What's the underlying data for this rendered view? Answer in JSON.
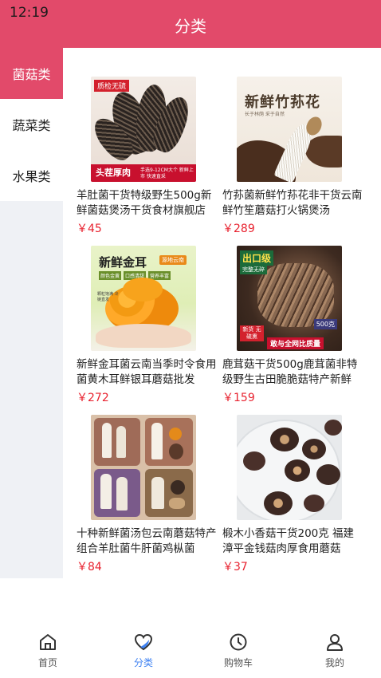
{
  "status_bar": {
    "time": "12:19"
  },
  "header": {
    "title": "分类"
  },
  "sidebar": {
    "items": [
      {
        "label": "菌菇类",
        "active": true
      },
      {
        "label": "蔬菜类",
        "active": false
      },
      {
        "label": "水果类",
        "active": false
      }
    ]
  },
  "products": [
    {
      "name": "羊肚菌干货特级野生500g新鲜菌菇煲汤干货食材旗舰店",
      "price": "￥45",
      "thumb": {
        "badge": "质检无硫",
        "caption": "头茬厚肉",
        "note": "手选9-12CM大个 新鲜上市 快速直采"
      }
    },
    {
      "name": "竹荪菌新鲜竹荪花非干货云南鲜竹笙蘑菇打火锅煲汤",
      "price": "￥289",
      "thumb": {
        "headline": "新鲜竹荪花",
        "note": "长于林荫 采于自然"
      }
    },
    {
      "name": "新鲜金耳菌云南当季时令食用菌黄木耳鲜银耳蘑菇批发",
      "price": "￥272",
      "thumb": {
        "headline": "新鲜金耳",
        "tag": "源地云南",
        "chips": [
          "颜色金黄",
          "口感清甜",
          "营养丰富"
        ],
        "note": "颗粒饱满 冷链直发"
      }
    },
    {
      "name": "鹿茸菇干货500g鹿茸菌非特级野生古田脆脆菇特产新鲜",
      "price": "￥159",
      "thumb": {
        "headline": "出口级",
        "sub": "完整无碎",
        "badge": "新货 无硫熏",
        "weight": "500克",
        "caption": "敢与全网比质量"
      }
    },
    {
      "name": "十种新鲜菌汤包云南蘑菇特产组合羊肚菌牛肝菌鸡枞菌",
      "price": "￥84",
      "thumb": {}
    },
    {
      "name": "椴木小香菇干货200克 福建漳平金钱菇肉厚食用蘑菇",
      "price": "￥37",
      "thumb": {}
    }
  ],
  "tabbar": {
    "items": [
      {
        "label": "首页",
        "icon": "home-icon",
        "active": false
      },
      {
        "label": "分类",
        "icon": "category-icon",
        "active": true
      },
      {
        "label": "购物车",
        "icon": "cart-clock-icon",
        "active": false
      },
      {
        "label": "我的",
        "icon": "user-icon",
        "active": false
      }
    ]
  },
  "colors": {
    "brand": "#e24a6a",
    "price": "#e8222f",
    "tab_active": "#3f82f2"
  }
}
